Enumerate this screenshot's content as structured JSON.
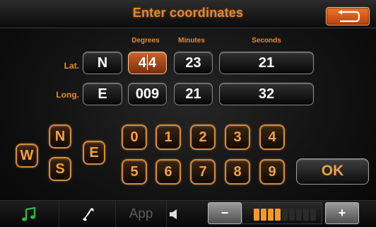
{
  "header": {
    "title": "Enter coordinates",
    "back_icon": "return-arrow-icon"
  },
  "columns": {
    "degrees": "Degrees",
    "minutes": "Minutes",
    "seconds": "Seconds"
  },
  "lat": {
    "label": "Lat.",
    "hemisphere": "N",
    "degrees": "44",
    "minutes": "23",
    "seconds": "21"
  },
  "long": {
    "label": "Long.",
    "hemisphere": "E",
    "degrees": "009",
    "minutes": "21",
    "seconds": "32"
  },
  "compass": {
    "n": "N",
    "w": "W",
    "e": "E",
    "s": "S"
  },
  "keypad": {
    "k0": "0",
    "k1": "1",
    "k2": "2",
    "k3": "3",
    "k4": "4",
    "k5": "5",
    "k6": "6",
    "k7": "7",
    "k8": "8",
    "k9": "9",
    "ok": "OK"
  },
  "bottombar": {
    "app": "App",
    "vol_minus": "−",
    "vol_plus": "+",
    "volume_level": 0.44,
    "icons": [
      "music-note-icon",
      "phone-icon",
      "speaker-icon"
    ]
  },
  "colors": {
    "accent": "#e8862e",
    "active_field": "#c9632c",
    "music_icon": "#2fb34a"
  }
}
